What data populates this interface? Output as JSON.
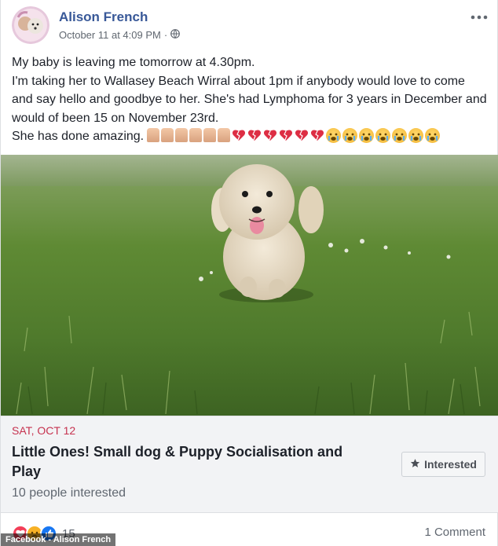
{
  "post": {
    "author": "Alison French",
    "timestamp": "October 11 at 4:09 PM",
    "separator": "·",
    "privacy_icon": "globe-icon",
    "more_icon": "more-options-icon",
    "text_lines": [
      "My baby is leaving me tomorrow at 4.30pm.",
      "I'm taking her to Wallasey Beach Wirral about 1pm if anybody would love to come and say hello and goodbye to her. She's had Lymphoma for 3 years in December and would of been 15 on November 23rd.",
      "She has done amazing."
    ]
  },
  "event": {
    "date": "SAT, OCT 12",
    "title": "Little Ones! Small dog & Puppy Socialisation and Play",
    "interested_count": "10 people interested",
    "button_label": "Interested",
    "button_icon": "star-icon"
  },
  "footer": {
    "reaction_count": "15",
    "comments": "1 Comment",
    "credit": "Facebook - Alison French"
  },
  "colors": {
    "author": "#385898",
    "event_date": "#c6324f",
    "grass": "#4f7a2c"
  }
}
